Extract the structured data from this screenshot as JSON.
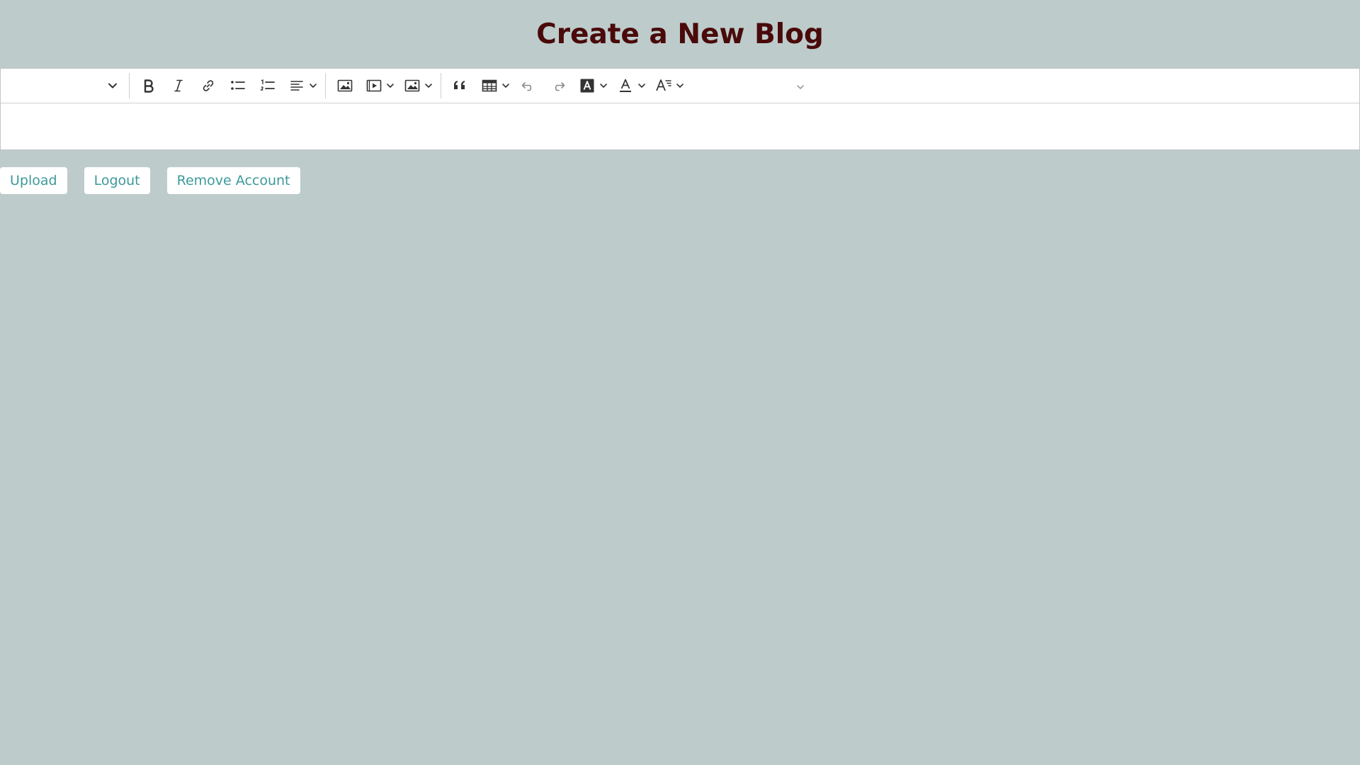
{
  "page": {
    "title": "Create a New Blog",
    "colors": {
      "background": "#bdcbcb",
      "title": "#4a0a0a",
      "button_text": "#3c9a9a",
      "button_bg": "#ffffff",
      "icon": "#333333"
    }
  },
  "editor": {
    "content": "",
    "toolbar": {
      "heading_select": {
        "value": "",
        "icon": "chevron-down-icon"
      },
      "buttons": [
        {
          "name": "bold",
          "icon": "bold-icon"
        },
        {
          "name": "italic",
          "icon": "italic-icon"
        },
        {
          "name": "link",
          "icon": "link-icon"
        },
        {
          "name": "bulleted-list",
          "icon": "bulleted-list-icon"
        },
        {
          "name": "numbered-list",
          "icon": "numbered-list-icon"
        },
        {
          "name": "alignment",
          "icon": "align-left-icon",
          "dropdown": true
        },
        {
          "name": "insert-image",
          "icon": "image-icon"
        },
        {
          "name": "media-embed",
          "icon": "media-embed-icon",
          "dropdown": true
        },
        {
          "name": "image-style",
          "icon": "image-style-icon",
          "dropdown": true
        },
        {
          "name": "block-quote",
          "icon": "quote-icon"
        },
        {
          "name": "insert-table",
          "icon": "table-icon",
          "dropdown": true
        },
        {
          "name": "undo",
          "icon": "undo-icon"
        },
        {
          "name": "redo",
          "icon": "redo-icon"
        },
        {
          "name": "font-background-color",
          "icon": "font-background-icon",
          "dropdown": true
        },
        {
          "name": "font-color",
          "icon": "font-color-icon",
          "dropdown": true
        },
        {
          "name": "font-size",
          "icon": "font-size-icon",
          "dropdown": true
        }
      ],
      "font_family_select": {
        "value": "",
        "icon": "chevron-down-icon"
      }
    }
  },
  "actions": {
    "upload_label": "Upload",
    "logout_label": "Logout",
    "remove_account_label": "Remove Account"
  }
}
